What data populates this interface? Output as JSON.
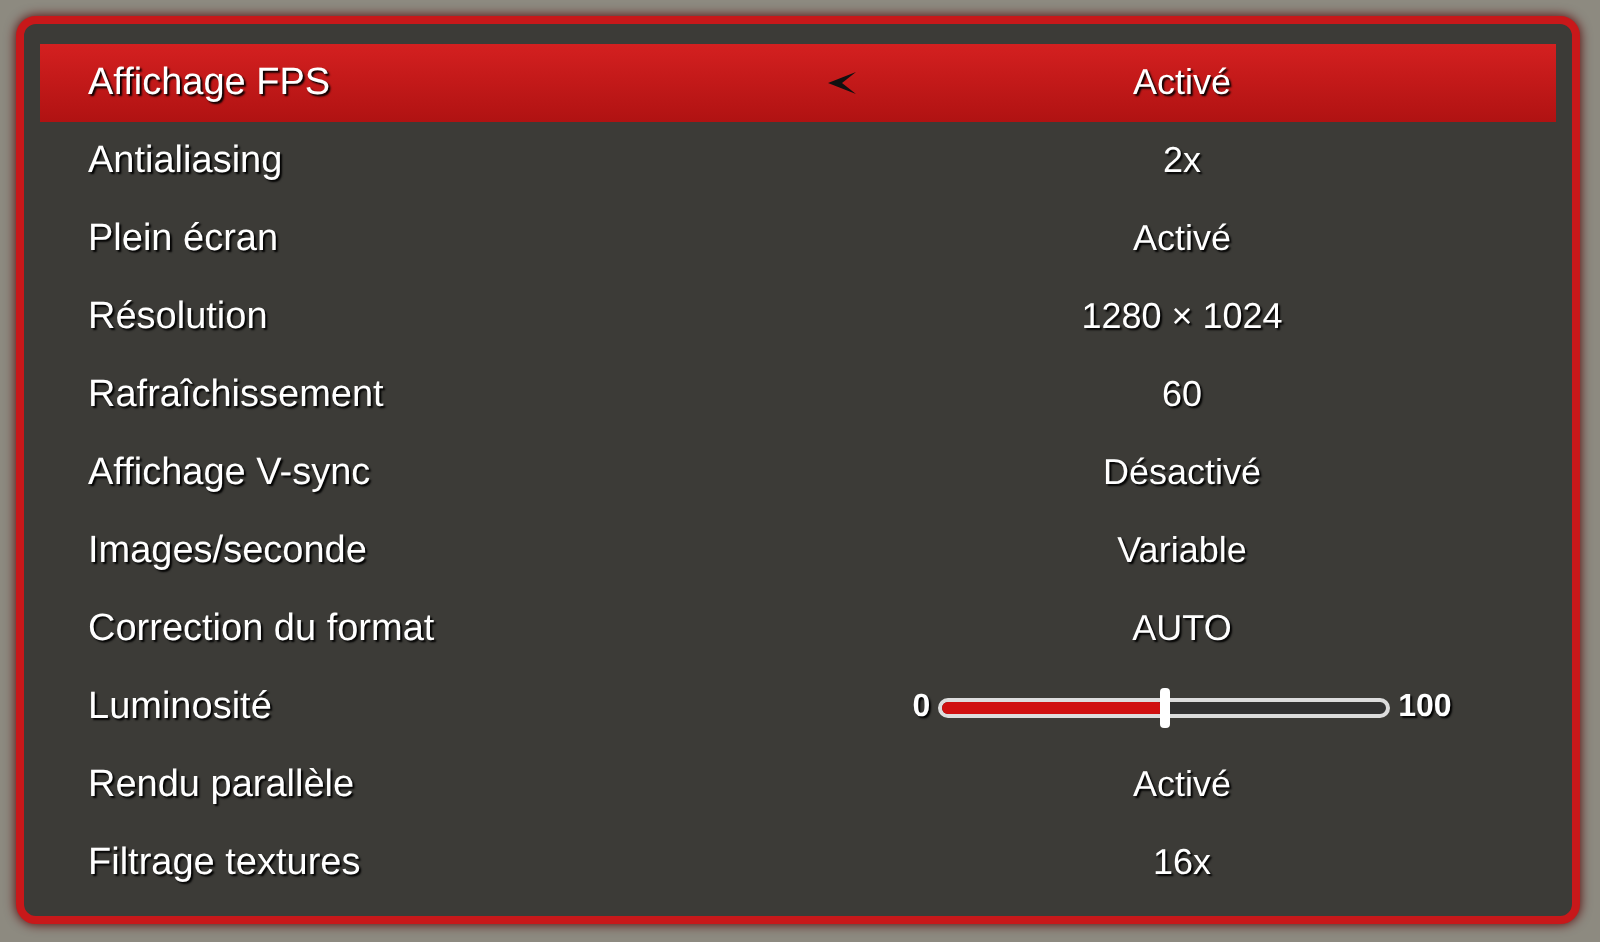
{
  "settings": [
    {
      "kind": "choice",
      "label": "Affichage FPS",
      "value": "Activé",
      "selected": true
    },
    {
      "kind": "choice",
      "label": "Antialiasing",
      "value": "2x",
      "selected": false
    },
    {
      "kind": "choice",
      "label": "Plein écran",
      "value": "Activé",
      "selected": false
    },
    {
      "kind": "choice",
      "label": "Résolution",
      "value": "1280 × 1024",
      "selected": false
    },
    {
      "kind": "choice",
      "label": "Rafraîchissement",
      "value": "60",
      "selected": false
    },
    {
      "kind": "choice",
      "label": "Affichage V-sync",
      "value": "Désactivé",
      "selected": false
    },
    {
      "kind": "choice",
      "label": "Images/seconde",
      "value": "Variable",
      "selected": false
    },
    {
      "kind": "choice",
      "label": "Correction du format",
      "value": "AUTO",
      "selected": false
    },
    {
      "kind": "slider",
      "label": "Luminosité",
      "min": "0",
      "max": "100",
      "level": 0.5,
      "selected": false
    },
    {
      "kind": "choice",
      "label": "Rendu parallèle",
      "value": "Activé",
      "selected": false
    },
    {
      "kind": "choice",
      "label": "Filtrage textures",
      "value": "16x",
      "selected": false
    }
  ]
}
